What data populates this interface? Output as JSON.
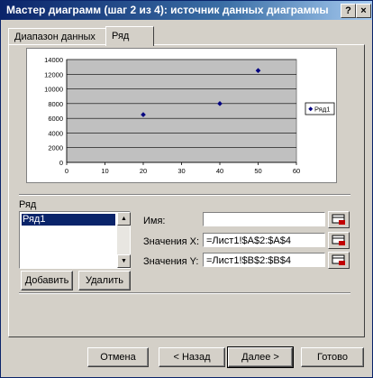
{
  "window": {
    "title": "Мастер диаграмм (шаг 2 из 4): источник данных диаграммы",
    "help_label": "?",
    "close_label": "×"
  },
  "tabs": [
    {
      "label": "Диапазон данных",
      "active": false
    },
    {
      "label": "Ряд",
      "active": true
    }
  ],
  "chart_data": {
    "type": "scatter",
    "x": [
      20,
      40,
      50
    ],
    "y": [
      6500,
      8000,
      12500
    ],
    "series": [
      {
        "name": "Ряд1",
        "x": [
          20,
          40,
          50
        ],
        "y": [
          6500,
          8000,
          12500
        ]
      }
    ],
    "xlim": [
      0,
      60
    ],
    "ylim": [
      0,
      14000
    ],
    "xticks": [
      "0",
      "10",
      "20",
      "30",
      "40",
      "50",
      "60"
    ],
    "yticks": [
      "0",
      "2000",
      "4000",
      "6000",
      "8000",
      "10000",
      "12000",
      "14000"
    ],
    "legend": "right",
    "grid": "horizontal",
    "plot_background": "#c0c0c0",
    "marker_color": "#000080"
  },
  "series_section": {
    "label": "Ряд",
    "items": [
      "Ряд1"
    ],
    "add_label": "Добавить",
    "remove_label": "Удалить",
    "name_label": "Имя:",
    "name_value": "",
    "x_label": "Значения X:",
    "x_value": "=Лист1!$A$2:$A$4",
    "y_label": "Значения Y:",
    "y_value": "=Лист1!$B$2:$B$4"
  },
  "footer": {
    "cancel_label": "Отмена",
    "back_label": "< Назад",
    "next_label": "Далее >",
    "finish_label": "Готово"
  }
}
